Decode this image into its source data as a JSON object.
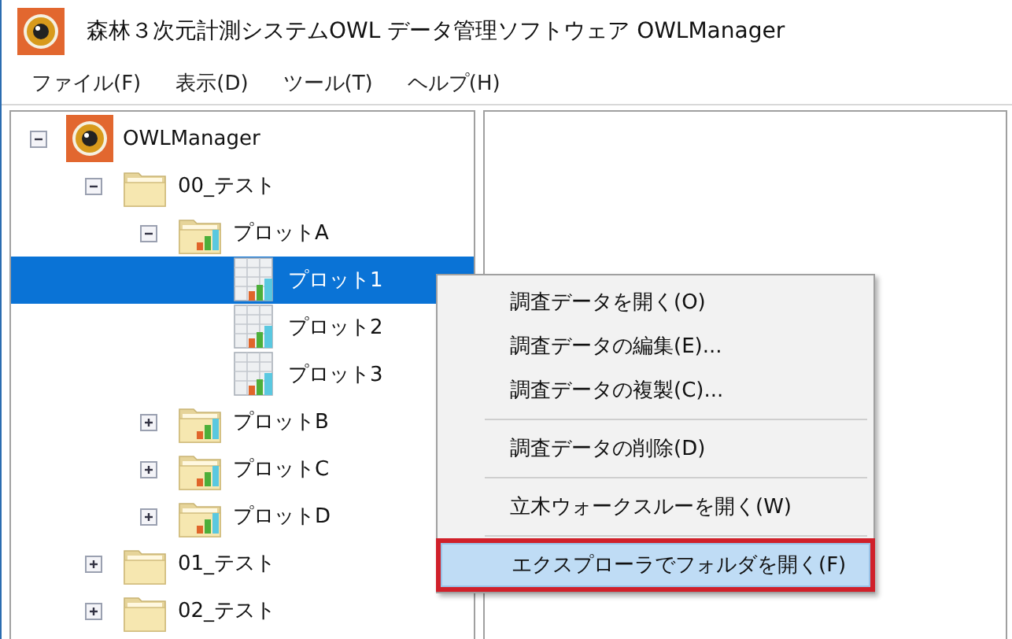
{
  "window": {
    "title": "森林３次元計測システムOWL データ管理ソフトウェア OWLManager"
  },
  "menu_bar": [
    "ファイル(F)",
    "表示(D)",
    "ツール(T)",
    "ヘルプ(H)"
  ],
  "tree": [
    {
      "kind": "root",
      "label": "OWLManager",
      "expanded": true,
      "selected": false,
      "children": [
        {
          "kind": "folder",
          "label": "00_テスト",
          "expanded": true,
          "selected": false,
          "children": [
            {
              "kind": "plot-folder",
              "label": "プロットA",
              "expanded": true,
              "selected": false,
              "children": [
                {
                  "kind": "plot",
                  "label": "プロット1",
                  "selected": true
                },
                {
                  "kind": "plot",
                  "label": "プロット2",
                  "selected": false
                },
                {
                  "kind": "plot",
                  "label": "プロット3",
                  "selected": false
                }
              ]
            },
            {
              "kind": "plot-folder",
              "label": "プロットB",
              "expanded": false,
              "selected": false
            },
            {
              "kind": "plot-folder",
              "label": "プロットC",
              "expanded": false,
              "selected": false
            },
            {
              "kind": "plot-folder",
              "label": "プロットD",
              "expanded": false,
              "selected": false
            }
          ]
        },
        {
          "kind": "folder",
          "label": "01_テスト",
          "expanded": false,
          "selected": false
        },
        {
          "kind": "folder",
          "label": "02_テスト",
          "expanded": false,
          "selected": false
        }
      ]
    }
  ],
  "context_menu": [
    {
      "kind": "item",
      "label": "調査データを開く(O)",
      "selected": false,
      "framed": false
    },
    {
      "kind": "item",
      "label": "調査データの編集(E)...",
      "selected": false,
      "framed": false
    },
    {
      "kind": "item",
      "label": "調査データの複製(C)...",
      "selected": false,
      "framed": false
    },
    {
      "kind": "separator"
    },
    {
      "kind": "item",
      "label": "調査データの削除(D)",
      "selected": false,
      "framed": false
    },
    {
      "kind": "separator"
    },
    {
      "kind": "item",
      "label": "立木ウォークスルーを開く(W)",
      "selected": false,
      "framed": false
    },
    {
      "kind": "separator"
    },
    {
      "kind": "item",
      "label": "エクスプローラでフォルダを開く(F)",
      "selected": true,
      "framed": true
    }
  ]
}
